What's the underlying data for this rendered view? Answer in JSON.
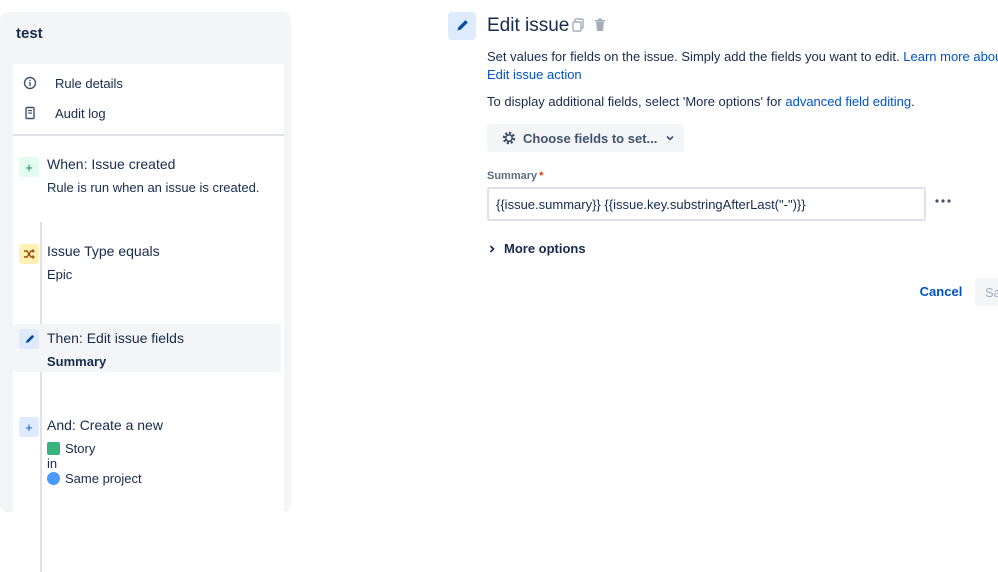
{
  "rule": {
    "name": "test"
  },
  "menu": [
    {
      "label": "Rule details",
      "icon": "info-icon"
    },
    {
      "label": "Audit log",
      "icon": "audit-log-icon"
    }
  ],
  "components": [
    {
      "title": "When: Issue created",
      "subtitle": "Rule is run when an issue is created.",
      "icon": "plus-icon",
      "color": "#e3fcef"
    },
    {
      "title": "Issue Type equals",
      "subtitle": "Epic",
      "icon": "shuffle-icon",
      "color": "#fff0b3"
    },
    {
      "title": "Then: Edit issue fields",
      "subtitle": "Summary",
      "icon": "pencil-icon",
      "color": "#deebff"
    },
    {
      "title": "And: Create a new",
      "line1": "Story",
      "line2": "in",
      "line3": "Same project",
      "icon": "plus-icon",
      "color": "#deebff"
    }
  ],
  "editor": {
    "title": "Edit issue",
    "description": "Set values for fields on the issue. Simply add the fields you want to edit.",
    "learn_more": "Learn more about",
    "learn_more_2": "Edit issue action",
    "additional_prefix": "To display additional fields, select 'More options' for",
    "advanced_link": "advanced field editing",
    "additional_suffix": ".",
    "choose_fields": "Choose fields to set...",
    "field_label": "Summary",
    "required_mark": "*",
    "summary_value": "{{issue.summary}} {{issue.key.substringAfterLast(\"-\")}}",
    "more_options": "More options",
    "cancel": "Cancel",
    "save": "Save"
  },
  "colors": {
    "accent": "#0052cc",
    "text": "#172b4d",
    "required": "#de350b"
  }
}
